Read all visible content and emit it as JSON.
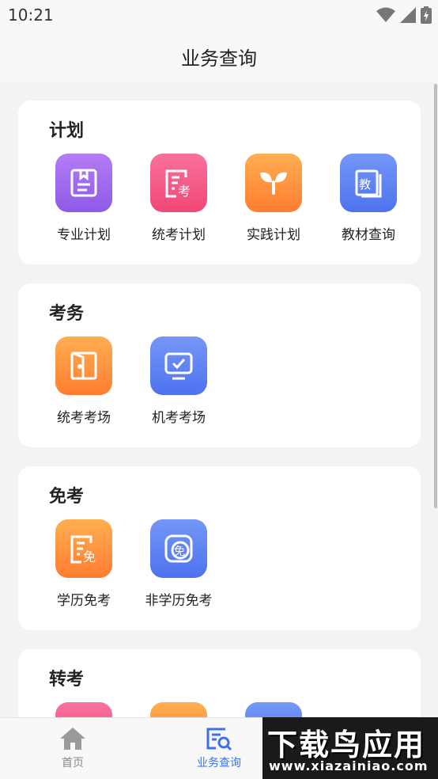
{
  "status_bar": {
    "time": "10:21",
    "icons": [
      "wifi-icon",
      "signal-icon",
      "battery-charging-icon"
    ]
  },
  "app_bar": {
    "title": "业务查询"
  },
  "sections": [
    {
      "title": "计划",
      "items": [
        {
          "label": "专业计划",
          "icon": "book-icon",
          "color": "purple"
        },
        {
          "label": "统考计划",
          "icon": "exam-doc-icon",
          "color": "pink"
        },
        {
          "label": "实践计划",
          "icon": "sprout-icon",
          "color": "orange"
        },
        {
          "label": "教材查询",
          "icon": "textbook-icon",
          "color": "blue"
        }
      ]
    },
    {
      "title": "考务",
      "items": [
        {
          "label": "统考考场",
          "icon": "door-icon",
          "color": "orange"
        },
        {
          "label": "机考考场",
          "icon": "monitor-check-icon",
          "color": "blue"
        }
      ]
    },
    {
      "title": "免考",
      "items": [
        {
          "label": "学历免考",
          "icon": "exempt-doc-icon",
          "color": "orange"
        },
        {
          "label": "非学历免考",
          "icon": "exempt-badge-icon",
          "color": "blue"
        }
      ]
    },
    {
      "title": "转考",
      "items": [
        {
          "label": "",
          "icon": "",
          "color": "pink"
        },
        {
          "label": "",
          "icon": "",
          "color": "orange"
        },
        {
          "label": "",
          "icon": "",
          "color": "blue"
        }
      ]
    }
  ],
  "bottom_nav": [
    {
      "label": "首页",
      "icon": "home-icon",
      "active": false
    },
    {
      "label": "业务查询",
      "icon": "query-icon",
      "active": true
    }
  ],
  "watermark": {
    "title": "下载鸟应用",
    "url": "www.xiazainiao.com"
  },
  "colors": {
    "accent": "#3e6ff0",
    "purple": "#9b67ee",
    "pink": "#f45782",
    "orange": "#ff9140",
    "blue": "#5f83f2"
  }
}
